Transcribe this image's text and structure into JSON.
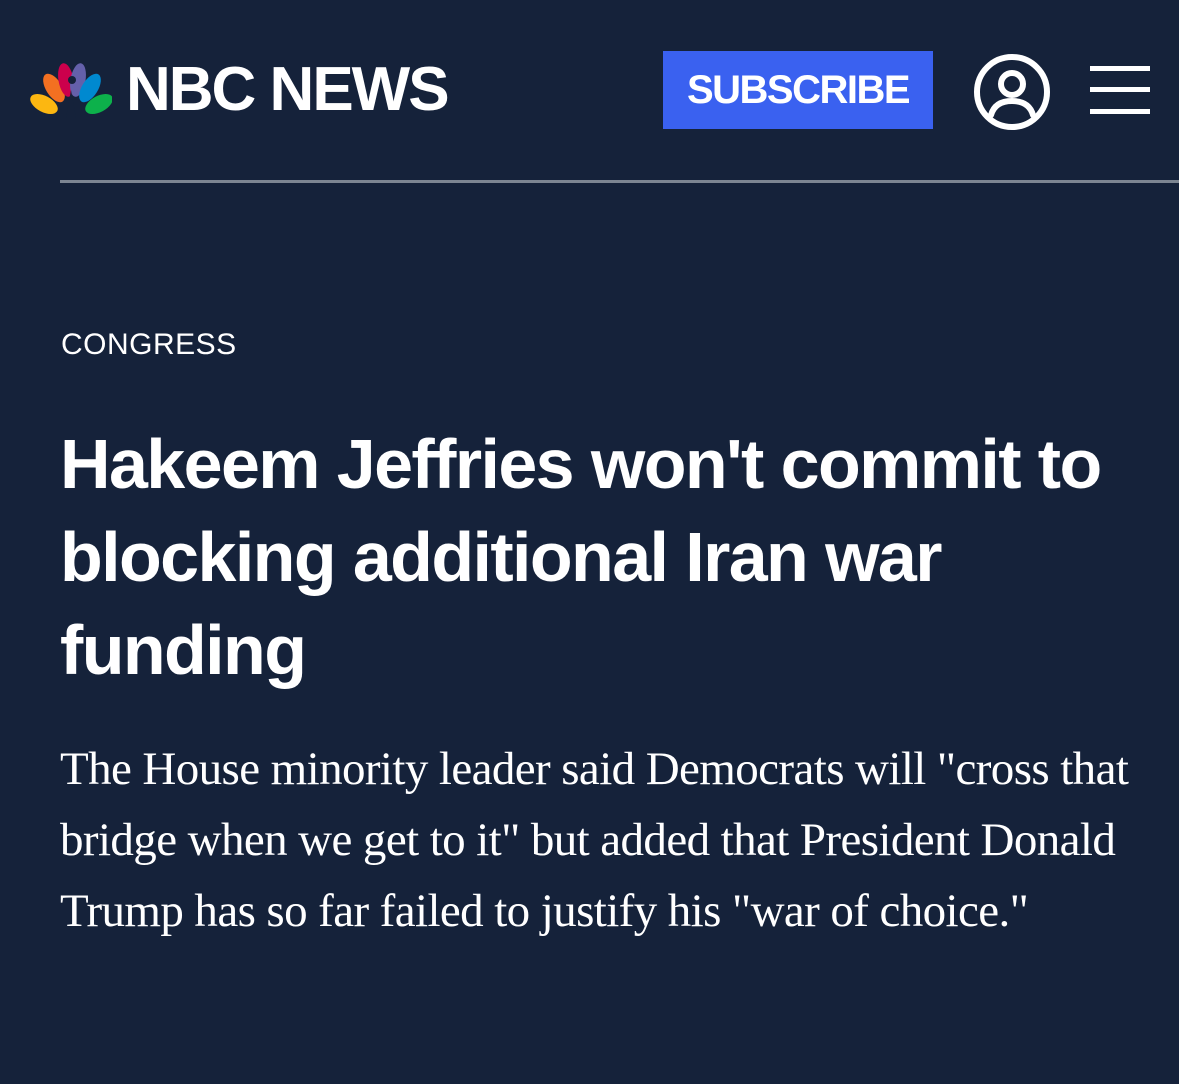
{
  "header": {
    "logo_text": "NBC NEWS",
    "subscribe_label": "SUBSCRIBE",
    "account_icon": "user-circle-icon",
    "menu_icon": "hamburger-menu-icon"
  },
  "article": {
    "section": "CONGRESS",
    "headline": "Hakeem Jeffries won't commit to blocking additional Iran war funding",
    "dek": "The House minority leader said Democrats will \"cross that bridge when we get to it\" but added that President Donald Trump has so far failed to justify his \"war of choice.\""
  },
  "colors": {
    "background": "#15223a",
    "subscribe_button": "#3a61f0",
    "divider": "#7c8592",
    "text": "#ffffff",
    "peacock": [
      "#fcb711",
      "#f37021",
      "#cc004c",
      "#6460aa",
      "#0089d0",
      "#0db14b"
    ]
  }
}
